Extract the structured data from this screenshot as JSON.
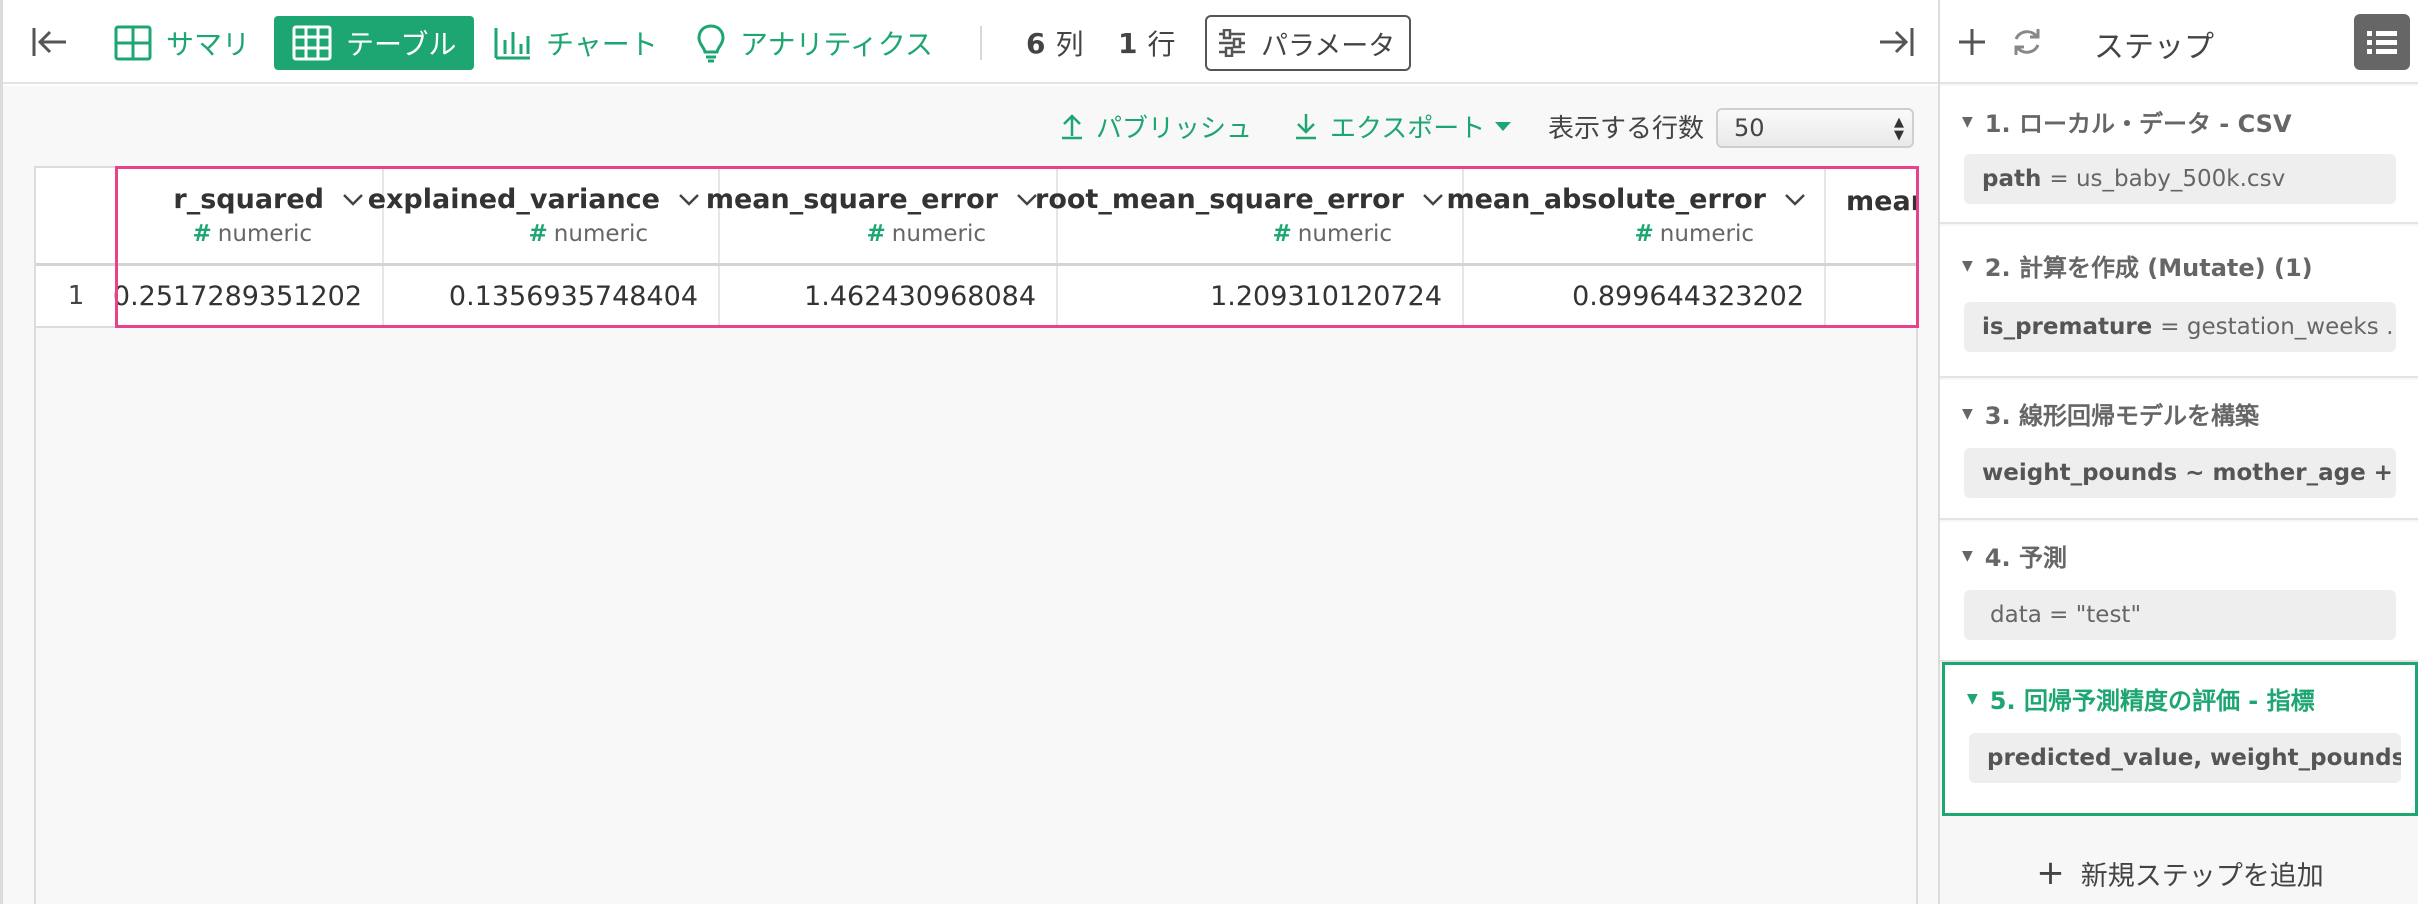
{
  "toolbar": {
    "tabs": [
      {
        "label": "サマリ"
      },
      {
        "label": "テーブル"
      },
      {
        "label": "チャート"
      },
      {
        "label": "アナリティクス"
      }
    ],
    "columns_count": "6",
    "columns_unit": "列",
    "rows_count": "1",
    "rows_unit": "行",
    "parameters_label": "パラメータ"
  },
  "actions": {
    "publish_label": "パブリッシュ",
    "export_label": "エクスポート",
    "rows_to_show_label": "表示する行数",
    "rows_to_show_value": "50"
  },
  "table": {
    "columns": [
      {
        "name": "r_squared",
        "type": "numeric"
      },
      {
        "name": "explained_variance",
        "type": "numeric"
      },
      {
        "name": "mean_square_error",
        "type": "numeric"
      },
      {
        "name": "root_mean_square_error",
        "type": "numeric"
      },
      {
        "name": "mean_absolute_error",
        "type": "numeric"
      },
      {
        "name": "mean",
        "type": ""
      }
    ],
    "rows": [
      {
        "num": "1",
        "cells": [
          "0.2517289351202",
          "0.1356935748404",
          "1.462430968084",
          "1.209310120724",
          "0.899644323202",
          ""
        ]
      }
    ]
  },
  "panel": {
    "title": "ステップ",
    "steps": [
      {
        "title": "1. ローカル・データ - CSV",
        "key": "path",
        "value": "= us_baby_500k.csv"
      },
      {
        "title": "2. 計算を作成 (Mutate) (1)",
        "key": "is_premature",
        "value": "= gestation_weeks …"
      },
      {
        "title": "3. 線形回帰モデルを構築",
        "key": "weight_pounds ~ mother_age + fa…",
        "value": ""
      },
      {
        "title": "4. 予測",
        "key": "",
        "value": "data = \"test\""
      },
      {
        "title": "5. 回帰予測精度の評価 - 指標",
        "key": "predicted_value, weight_pounds",
        "value": ""
      }
    ],
    "add_step_label": "新規ステップを追加"
  },
  "colors": {
    "accent": "#1ea672",
    "highlight": "#e8438a",
    "text": "#333333"
  }
}
